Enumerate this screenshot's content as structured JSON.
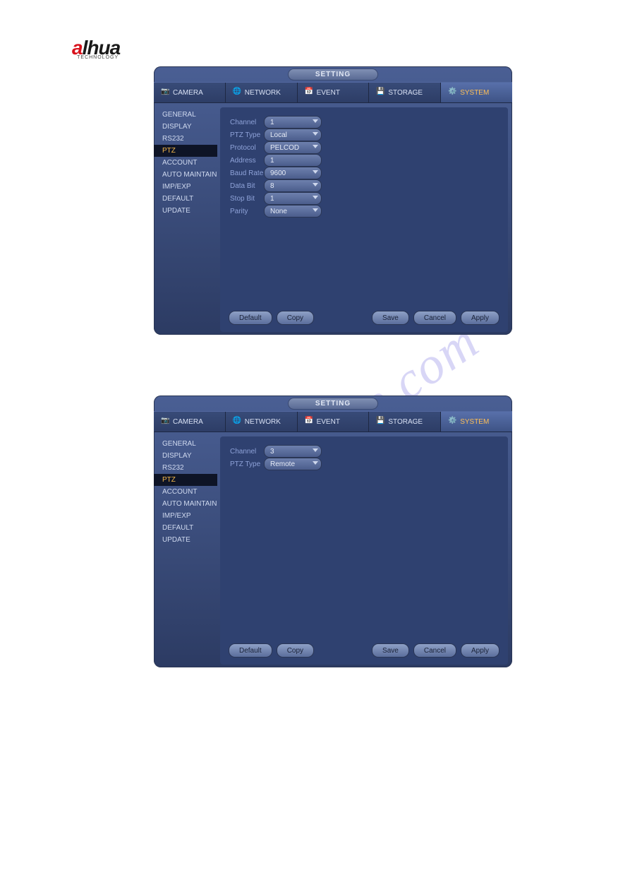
{
  "logo": {
    "brand1": "a",
    "brand2": "lhua",
    "sub": "TECHNOLOGY"
  },
  "watermark": "manualshive.com",
  "panel1": {
    "title": "SETTING",
    "tabs": [
      {
        "label": "CAMERA",
        "active": false
      },
      {
        "label": "NETWORK",
        "active": false
      },
      {
        "label": "EVENT",
        "active": false
      },
      {
        "label": "STORAGE",
        "active": false
      },
      {
        "label": "SYSTEM",
        "active": true
      }
    ],
    "sidebar": [
      {
        "label": "GENERAL",
        "active": false
      },
      {
        "label": "DISPLAY",
        "active": false
      },
      {
        "label": "RS232",
        "active": false
      },
      {
        "label": "PTZ",
        "active": true
      },
      {
        "label": "ACCOUNT",
        "active": false
      },
      {
        "label": "AUTO MAINTAIN",
        "active": false
      },
      {
        "label": "IMP/EXP",
        "active": false
      },
      {
        "label": "DEFAULT",
        "active": false
      },
      {
        "label": "UPDATE",
        "active": false
      }
    ],
    "form": {
      "channel_label": "Channel",
      "channel_value": "1",
      "ptztype_label": "PTZ Type",
      "ptztype_value": "Local",
      "protocol_label": "Protocol",
      "protocol_value": "PELCOD",
      "address_label": "Address",
      "address_value": "1",
      "baud_label": "Baud Rate",
      "baud_value": "9600",
      "databit_label": "Data Bit",
      "databit_value": "8",
      "stopbit_label": "Stop Bit",
      "stopbit_value": "1",
      "parity_label": "Parity",
      "parity_value": "None"
    },
    "buttons": {
      "default": "Default",
      "copy": "Copy",
      "save": "Save",
      "cancel": "Cancel",
      "apply": "Apply"
    }
  },
  "panel2": {
    "title": "SETTING",
    "tabs": [
      {
        "label": "CAMERA",
        "active": false
      },
      {
        "label": "NETWORK",
        "active": false
      },
      {
        "label": "EVENT",
        "active": false
      },
      {
        "label": "STORAGE",
        "active": false
      },
      {
        "label": "SYSTEM",
        "active": true
      }
    ],
    "sidebar": [
      {
        "label": "GENERAL",
        "active": false
      },
      {
        "label": "DISPLAY",
        "active": false
      },
      {
        "label": "RS232",
        "active": false
      },
      {
        "label": "PTZ",
        "active": true
      },
      {
        "label": "ACCOUNT",
        "active": false
      },
      {
        "label": "AUTO MAINTAIN",
        "active": false
      },
      {
        "label": "IMP/EXP",
        "active": false
      },
      {
        "label": "DEFAULT",
        "active": false
      },
      {
        "label": "UPDATE",
        "active": false
      }
    ],
    "form": {
      "channel_label": "Channel",
      "channel_value": "3",
      "ptztype_label": "PTZ Type",
      "ptztype_value": "Remote"
    },
    "buttons": {
      "default": "Default",
      "copy": "Copy",
      "save": "Save",
      "cancel": "Cancel",
      "apply": "Apply"
    }
  }
}
